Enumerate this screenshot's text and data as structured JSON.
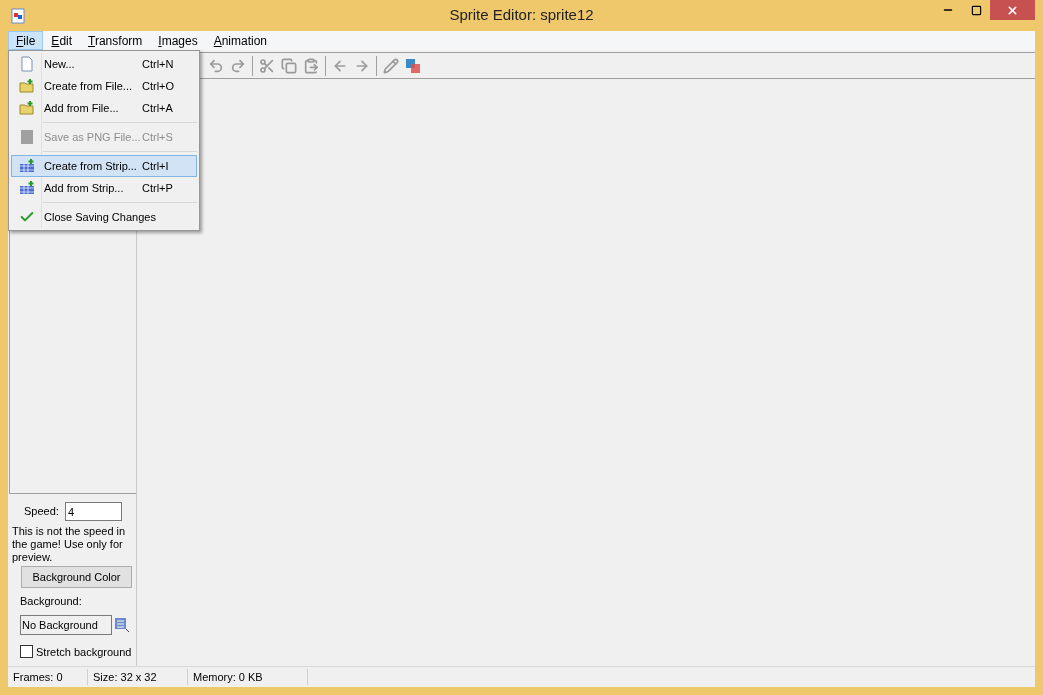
{
  "window": {
    "title": "Sprite Editor: sprite12"
  },
  "menu_bar": [
    {
      "label": "File",
      "selected": true
    },
    {
      "label": "Edit",
      "selected": false
    },
    {
      "label": "Transform",
      "selected": false
    },
    {
      "label": "Images",
      "selected": false
    },
    {
      "label": "Animation",
      "selected": false
    }
  ],
  "file_menu": [
    {
      "kind": "item",
      "label": "New...",
      "shortcut": "Ctrl+N",
      "disabled": false,
      "selected": false
    },
    {
      "kind": "item",
      "label": "Create from File...",
      "shortcut": "Ctrl+O",
      "disabled": false,
      "selected": false
    },
    {
      "kind": "item",
      "label": "Add from File...",
      "shortcut": "Ctrl+A",
      "disabled": false,
      "selected": false
    },
    {
      "kind": "separator"
    },
    {
      "kind": "item",
      "label": "Save as PNG File...",
      "shortcut": "Ctrl+S",
      "disabled": true,
      "selected": false
    },
    {
      "kind": "separator"
    },
    {
      "kind": "item",
      "label": "Create from Strip...",
      "shortcut": "Ctrl+I",
      "disabled": false,
      "selected": true
    },
    {
      "kind": "item",
      "label": "Add from Strip...",
      "shortcut": "Ctrl+P",
      "disabled": false,
      "selected": false
    },
    {
      "kind": "separator"
    },
    {
      "kind": "item",
      "label": "Close Saving Changes",
      "disabled": false,
      "selected": false
    }
  ],
  "panel": {
    "speed_label": "Speed:",
    "speed_value": "4",
    "note": "This is not the speed in the game! Use only for preview.",
    "background_color_button": "Background Color",
    "background_label": "Background:",
    "background_value": "No Background",
    "stretch": {
      "label": "Stretch background",
      "checked": false
    }
  },
  "status_bar": [
    "Frames: 0",
    "Size: 32 x 32",
    "Memory: 0 KB"
  ]
}
